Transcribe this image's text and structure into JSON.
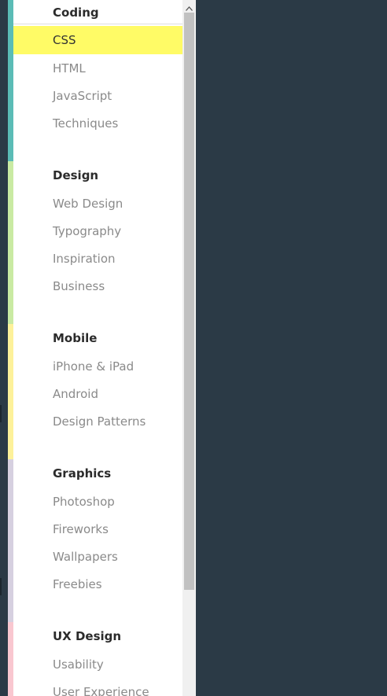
{
  "colors": {
    "panel_bg": "#ffffff",
    "page_bg": "#2b3a46",
    "active_highlight": "#fffb66",
    "accents": [
      "#5bbcb6",
      "#c9eaa3",
      "#fdf19a",
      "#d6d0e0",
      "#f9c7d0"
    ]
  },
  "sections": [
    {
      "title": "Coding",
      "items": [
        "CSS",
        "HTML",
        "JavaScript",
        "Techniques"
      ]
    },
    {
      "title": "Design",
      "items": [
        "Web Design",
        "Typography",
        "Inspiration",
        "Business"
      ]
    },
    {
      "title": "Mobile",
      "items": [
        "iPhone & iPad",
        "Android",
        "Design Patterns"
      ]
    },
    {
      "title": "Graphics",
      "items": [
        "Photoshop",
        "Fireworks",
        "Wallpapers",
        "Freebies"
      ]
    },
    {
      "title": "UX Design",
      "items": [
        "Usability",
        "User Experience"
      ]
    }
  ],
  "active_item": "CSS",
  "scrollbar": {
    "up_icon": "chevron-up-icon"
  }
}
